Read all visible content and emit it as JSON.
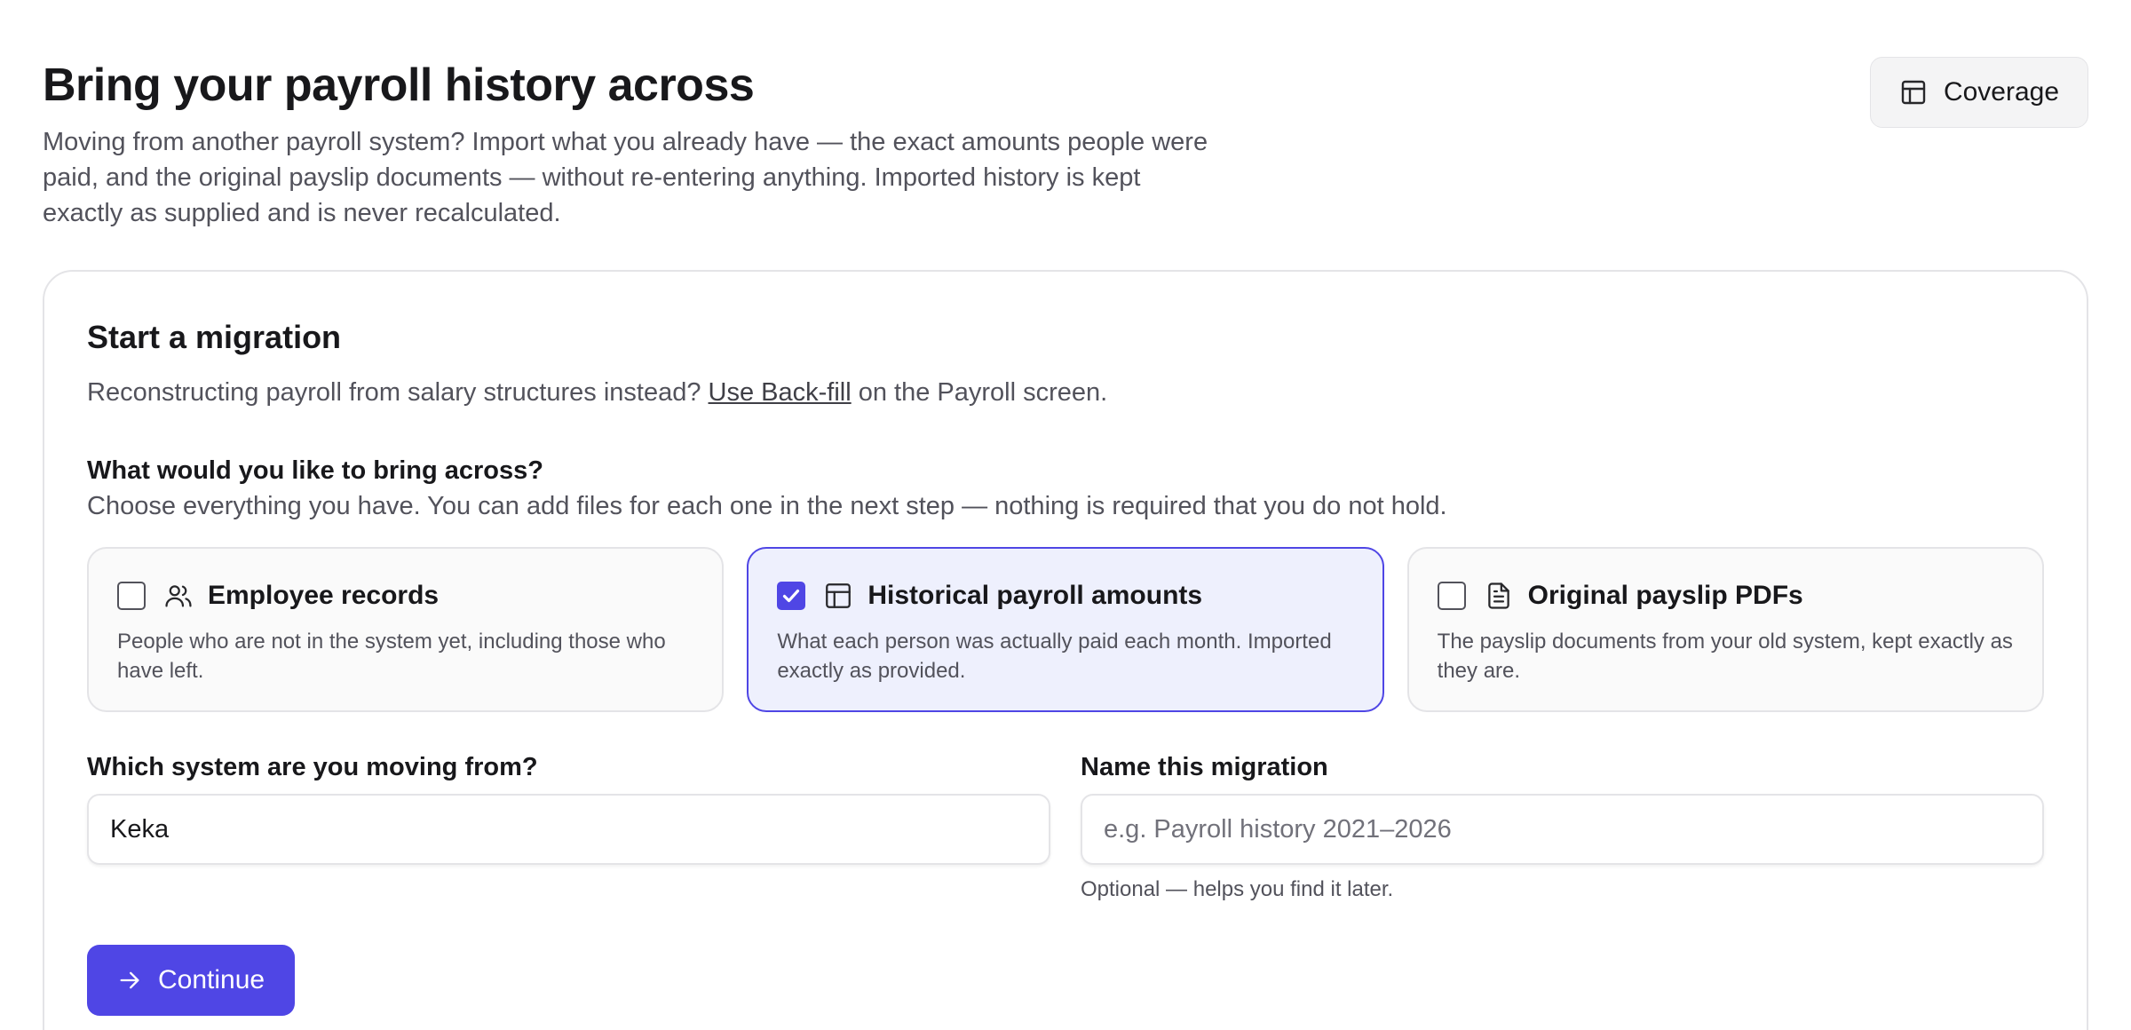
{
  "header": {
    "title": "Bring your payroll history across",
    "subtitle": "Moving from another payroll system? Import what you already have — the exact amounts people were paid, and the original payslip documents — without re-entering anything. Imported history is kept exactly as supplied and is never recalculated.",
    "coverage_label": "Coverage",
    "coverage_icon": "table-icon"
  },
  "card": {
    "title": "Start a migration",
    "desc_prefix": "Reconstructing payroll from salary structures instead? ",
    "desc_link": "Use Back-fill",
    "desc_suffix": " on the Payroll screen.",
    "question": "What would you like to bring across?",
    "question_sub": "Choose everything you have. You can add files for each one in the next step — nothing is required that you do not hold.",
    "options": [
      {
        "title": "Employee records",
        "desc": "People who are not in the system yet, including those who have left.",
        "icon": "users-icon",
        "checked": false
      },
      {
        "title": "Historical payroll amounts",
        "desc": "What each person was actually paid each month. Imported exactly as provided.",
        "icon": "table-icon",
        "checked": true
      },
      {
        "title": "Original payslip PDFs",
        "desc": "The payslip documents from your old system, kept exactly as they are.",
        "icon": "document-icon",
        "checked": false
      }
    ],
    "source_label": "Which system are you moving from?",
    "source_value": "Keka",
    "name_label": "Name this migration",
    "name_placeholder": "e.g. Payroll history 2021–2026",
    "name_value": "",
    "name_hint": "Optional — helps you find it later.",
    "continue_label": "Continue",
    "continue_icon": "arrow-right-icon"
  },
  "colors": {
    "accent": "#4f46e5",
    "selected_bg": "#eef0fd",
    "muted_text": "#52525b",
    "border": "#e4e4e7"
  }
}
